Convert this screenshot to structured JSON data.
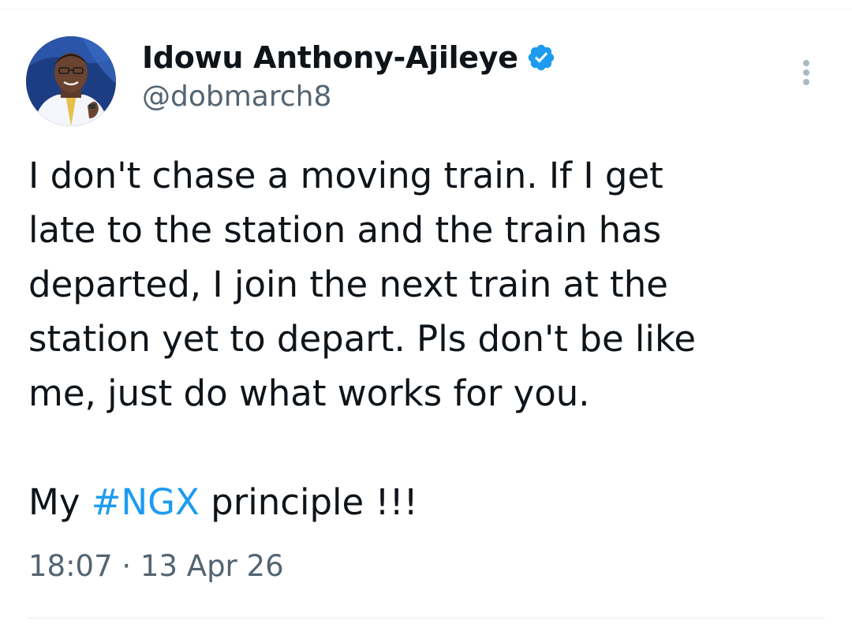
{
  "tweet": {
    "author": {
      "display_name": "Idowu Anthony-Ajileye",
      "handle": "@dobmarch8",
      "verified": true,
      "verified_color": "#1d9bf0"
    },
    "body_lines": [
      "I don't chase a moving train. If I get",
      "late to the station and the train has",
      "departed, I join the next train at the",
      "station yet to depart. Pls don't be like",
      "me, just do what works for you."
    ],
    "closing": {
      "prefix": "My ",
      "hashtag": "#NGX",
      "suffix": " principle !!!"
    },
    "timestamp": "18:07 · 13 Apr 26",
    "hashtag_color": "#1d9bf0",
    "icons": {
      "more": "more-options-icon",
      "verified": "verified-badge-icon"
    }
  }
}
